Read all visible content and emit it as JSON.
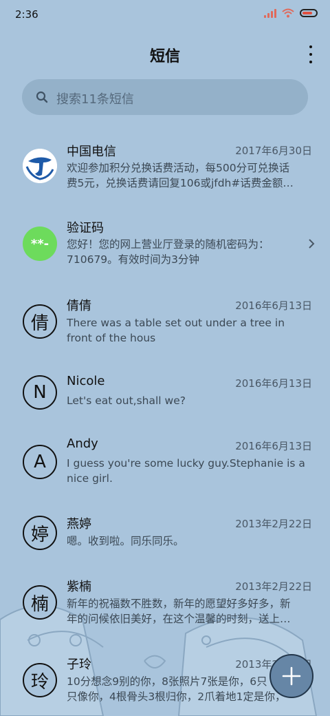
{
  "status": {
    "time": "2:36"
  },
  "header": {
    "title": "短信"
  },
  "search": {
    "placeholder": "搜索11条短信"
  },
  "conversations": [
    {
      "avatar_text": "",
      "avatar_type": "telecom-logo",
      "name": "中国电信",
      "date": "2017年6月30日",
      "line1": "欢迎参加积分兑换话费活动，每500分可兑换话",
      "line2": "费5元，兑换话费请回复106或jfdh#话费金额…"
    },
    {
      "avatar_text": "**-",
      "avatar_type": "code",
      "name": "验证码",
      "date": "",
      "line1": "您好！您的网上营业厅登录的随机密码为：",
      "line2": "710679。有效时间为3分钟"
    },
    {
      "avatar_text": "倩",
      "name": "倩倩",
      "date": "2016年6月13日",
      "line1": "There was a table set out under a tree in",
      "line2": "front of the hous"
    },
    {
      "avatar_text": "N",
      "name": "Nicole",
      "date": "2016年6月13日",
      "line1": "Let's eat out,shall we?",
      "line2": ""
    },
    {
      "avatar_text": "A",
      "name": "Andy",
      "date": "2016年6月13日",
      "line1": "I guess you're some lucky guy.Stephanie is a",
      "line2": "nice girl."
    },
    {
      "avatar_text": "婷",
      "name": "燕婷",
      "date": "2013年2月22日",
      "line1": "嗯。收到啦。同乐同乐。",
      "line2": ""
    },
    {
      "avatar_text": "楠",
      "name": "紫楠",
      "date": "2013年2月22日",
      "line1": "新年的祝福数不胜数，新年的愿望好多好多，新",
      "line2": "年的问候依旧美好，在这个温馨的时刻，送上…"
    },
    {
      "avatar_text": "玲",
      "name": "子玲",
      "date": "2013年2月22日",
      "line1": "10分想念9别的你，8张照片7张是你，6只",
      "line2": "只像你，4根骨头3根归你，2爪着地1定是你，"
    }
  ],
  "colors": {
    "background": "#a9c4dc",
    "fab": "#6686a6",
    "code_avatar": "#6ddb5c",
    "telecom": "#1e5aa8"
  },
  "icons": {
    "search": "search-icon",
    "menu": "more-vert-icon",
    "fab": "plus-icon",
    "chevron": "chevron-right-icon"
  }
}
